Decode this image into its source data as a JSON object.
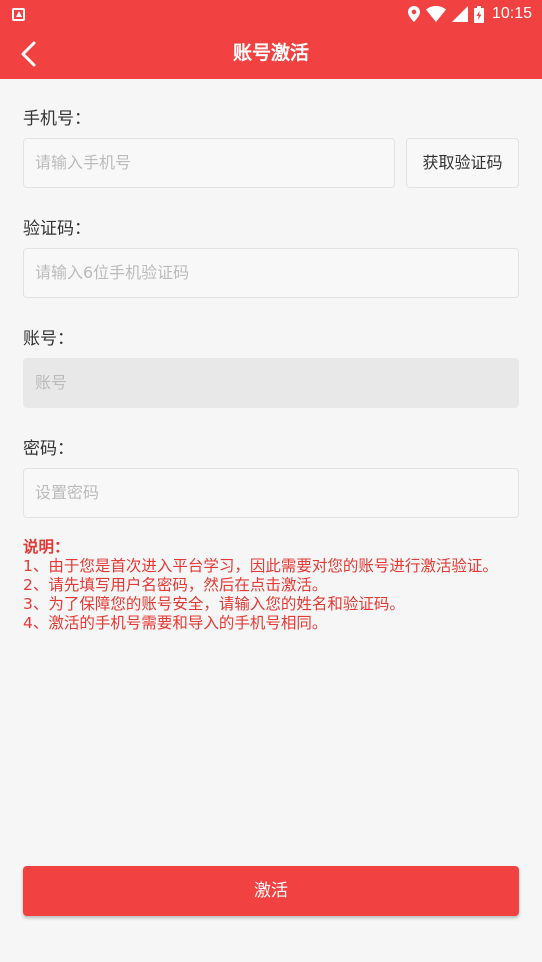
{
  "status_bar": {
    "time": "10:15",
    "icons": [
      "notification-icon",
      "location-icon",
      "wifi-icon",
      "signal-icon",
      "battery-icon"
    ]
  },
  "app_bar": {
    "title": "账号激活",
    "back_icon": "back-arrow-icon"
  },
  "form": {
    "phone": {
      "label": "手机号：",
      "placeholder": "请输入手机号",
      "get_code_label": "获取验证码"
    },
    "code": {
      "label": "验证码：",
      "placeholder": "请输入6位手机验证码"
    },
    "account": {
      "label": "账号：",
      "placeholder": "账号"
    },
    "password": {
      "label": "密码：",
      "placeholder": "设置密码"
    }
  },
  "notes": {
    "title": "说明：",
    "items": [
      "1、由于您是首次进入平台学习，因此需要对您的账号进行激活验证。",
      "2、请先填写用户名密码，然后在点击激活。",
      "3、为了保障您的账号安全，请输入您的姓名和验证码。",
      "4、激活的手机号需要和导入的手机号相同。"
    ]
  },
  "activate_button": {
    "label": "激活"
  },
  "colors": {
    "primary": "#f24141",
    "note_text": "#e53935",
    "background": "#f6f6f6"
  }
}
